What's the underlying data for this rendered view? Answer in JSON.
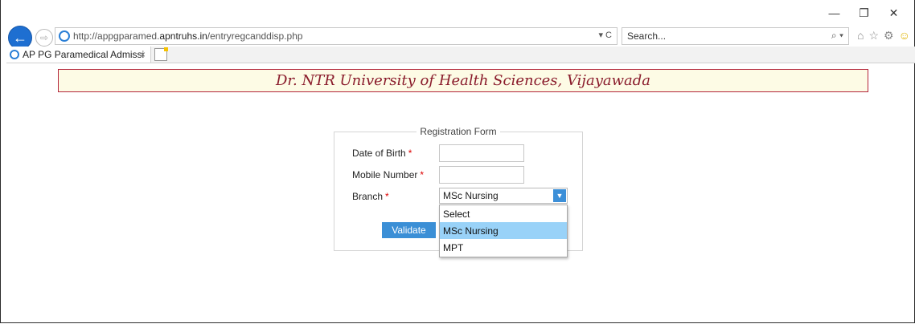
{
  "browser": {
    "window_controls": {
      "minimize": "—",
      "restore": "❐",
      "close": "✕"
    },
    "back_icon": "back-arrow-icon",
    "forward_icon": "forward-arrow-icon",
    "url_prefix": "http://appgparamed.",
    "url_domain": "apntruhs.in",
    "url_path": "/entryregcanddisp.php",
    "address_controls": "▾ C",
    "search_placeholder": "Search...",
    "search_icon_glyph": "⌕ ▾",
    "toolbar_icons": [
      "home-icon",
      "favorites-star-icon",
      "settings-gear-icon",
      "feedback-smiley-icon"
    ],
    "tab": {
      "title": "AP PG Paramedical Admissi",
      "close": "×"
    }
  },
  "page": {
    "banner_title": "Dr. NTR University of Health Sciences, Vijayawada",
    "form": {
      "legend": "Registration Form",
      "dob_label": "Date of Birth",
      "mobile_label": "Mobile Number",
      "branch_label": "Branch",
      "required_mark": "*",
      "dob_value": "",
      "mobile_value": "",
      "branch_selected": "MSc Nursing",
      "branch_options": [
        "Select",
        "MSc Nursing",
        "MPT"
      ],
      "validate_label": "Validate"
    }
  },
  "colors": {
    "banner_text": "#8a1c2c",
    "banner_bg": "#fdfbe5",
    "banner_border": "#b3243a",
    "button_bg": "#3b8fd6",
    "highlight": "#99d2f8",
    "required": "#dd0000"
  }
}
